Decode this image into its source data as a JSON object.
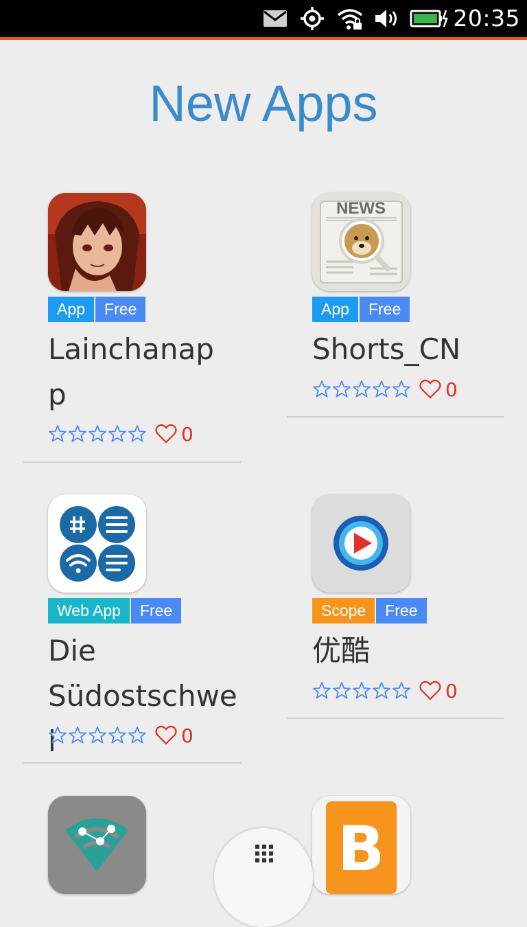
{
  "status_bar": {
    "time": "20:35",
    "icons": [
      "mail-icon",
      "location-icon",
      "wifi-icon",
      "volume-icon",
      "battery-charging-icon"
    ]
  },
  "page": {
    "title": "New Apps"
  },
  "apps": [
    {
      "name": "Lainchanap\np",
      "badges": [
        "App",
        "Free"
      ],
      "rating_stars": 0,
      "likes": "0",
      "icon": "anime-portrait-icon"
    },
    {
      "name": "Shorts_CN",
      "badges": [
        "App",
        "Free"
      ],
      "rating_stars": 0,
      "likes": "0",
      "icon": "news-doge-icon"
    },
    {
      "name": "Die\nSüdostschwei",
      "badges": [
        "Web App",
        "Free"
      ],
      "rating_stars": 0,
      "likes": "0",
      "icon": "sudostschweiz-grid-icon"
    },
    {
      "name": "优酷",
      "badges": [
        "Scope",
        "Free"
      ],
      "rating_stars": 0,
      "likes": "0",
      "icon": "youku-play-icon"
    },
    {
      "name": "",
      "badges": [],
      "icon": "wifi-network-icon"
    },
    {
      "name": "",
      "badges": [],
      "icon": "blogger-b-icon"
    }
  ],
  "colors": {
    "accent_title": "#3b8bcc",
    "badge_app": "#1d9bf0",
    "badge_free": "#4a8af4",
    "badge_webapp": "#19b6c9",
    "badge_scope": "#f7941d",
    "status_line": "#e95420",
    "likes": "#e0321e"
  },
  "fab": {
    "icon": "apps-grid-icon"
  }
}
